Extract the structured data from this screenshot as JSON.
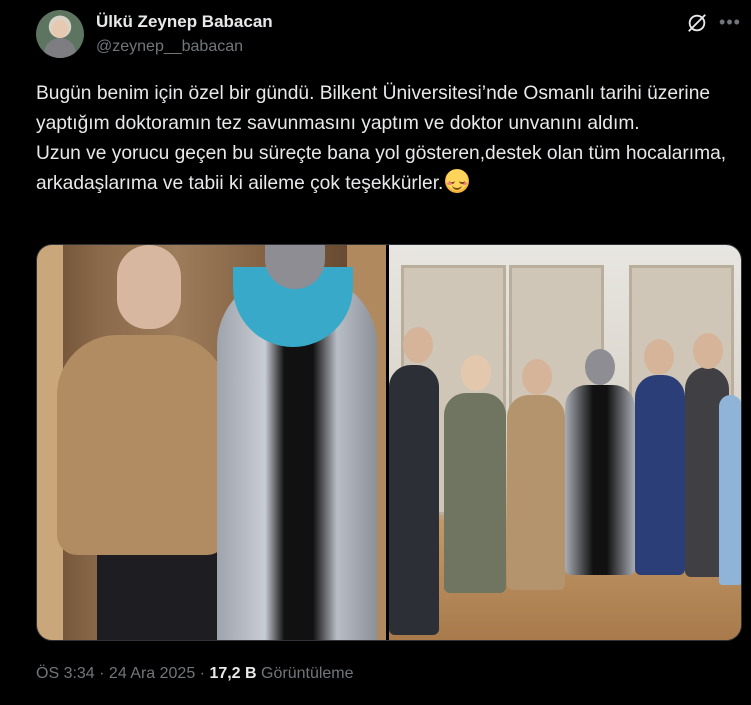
{
  "author": {
    "display_name": "Ülkü Zeynep Babacan",
    "handle": "@zeynep__babacan"
  },
  "tweet": {
    "text": "Bugün benim için özel bir gündü. Bilkent Üniversitesi’nde Osmanlı tarihi üzerine yaptığım doktoramın tez savunmasını yaptım ve doktor unvanını aldım.\nUzun ve yorucu geçen bu süreçte bana yol gösteren,destek olan tüm hocalarıma, arkadaşlarıma ve tabii ki aileme çok teşekkürler.",
    "emoji_icon": "smiling-face-with-blush-emoji"
  },
  "media": [
    {
      "icon": "photo-graduation-two-people"
    },
    {
      "icon": "photo-group-library"
    }
  ],
  "meta": {
    "time": "ÖS 3:34",
    "separator1": " · ",
    "date": "24 Ara 2025",
    "separator2": " · ",
    "views_count": "17,2 B",
    "views_label": " Görüntüleme"
  },
  "icons": {
    "grok": "grok-icon",
    "more": "more-options-icon"
  },
  "colors": {
    "background": "#000000",
    "text_primary": "#e7e9ea",
    "text_secondary": "#71767b",
    "border": "#2f3336"
  }
}
